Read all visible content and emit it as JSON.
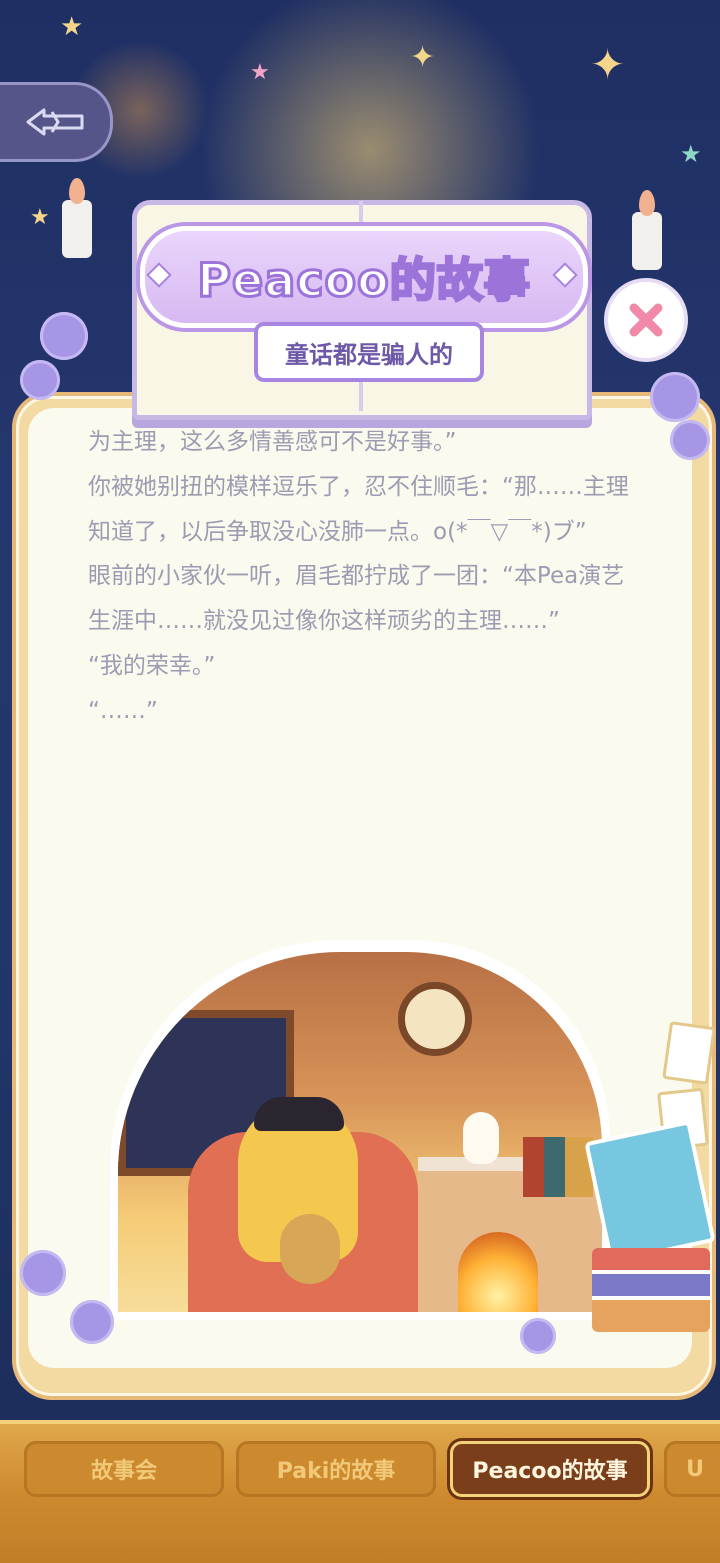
{
  "header": {
    "title": "Peacoo的故事",
    "subtitle": "童话都是骗人的"
  },
  "story": {
    "lines": [
      "为主理，这么多情善感可不是好事。”",
      "你被她别扭的模样逗乐了，忍不住顺毛：“那……主理知道了，以后争取没心没肺一点。o(*￣▽￣*)ブ”",
      "眼前的小家伙一听，眉毛都拧成了一团：“本Pea演艺生涯中……就没见过像你这样顽劣的主理……”",
      "“我的荣幸。”",
      "“……”"
    ]
  },
  "tabs": [
    {
      "label": "故事会",
      "active": false
    },
    {
      "label": "Paki的故事",
      "active": false
    },
    {
      "label": "Peacoo的故事",
      "active": true
    },
    {
      "label": "U",
      "active": false
    }
  ],
  "icons": {
    "back": "back-arrow-icon",
    "close": "close-icon"
  },
  "colors": {
    "accent_purple": "#9c74d9",
    "close_pink": "#f08aa8",
    "active_tab": "#7a3f1a",
    "story_text": "#9d9bb1"
  }
}
